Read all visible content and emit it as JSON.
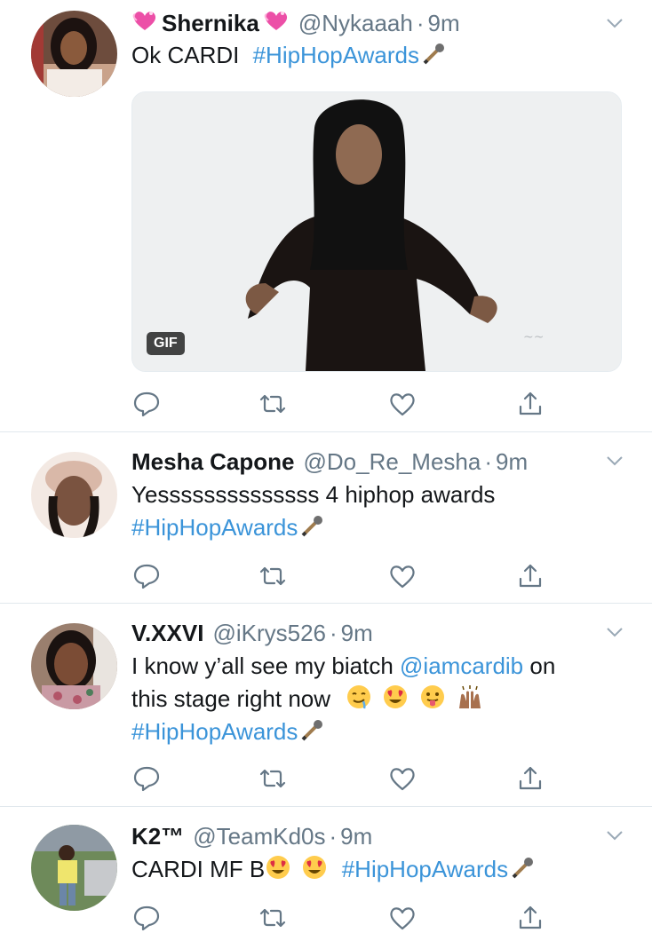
{
  "tweets": [
    {
      "display_name": "Shernika",
      "handle": "@Nykaaah",
      "time": "9m",
      "line1_text": "Ok CARDI",
      "line1_hashtag": "#HipHopAwards",
      "media_badge": "GIF"
    },
    {
      "display_name": "Mesha Capone",
      "handle": "@Do_Re_Mesha",
      "time": "9m",
      "line1_text": "Yessssssssssssss 4 hiphop awards",
      "line2_hashtag": "#HipHopAwards"
    },
    {
      "display_name": "V.XXVI",
      "handle": "@iKrys526",
      "time": "9m",
      "line1_text": "I know y’all see my biatch",
      "line1_mention": "@iamcardib",
      "line1_suffix": "on",
      "line2_text": "this stage right now",
      "line3_hashtag": "#HipHopAwards"
    },
    {
      "display_name": "K2™",
      "handle": "@TeamKd0s",
      "time": "9m",
      "line1_text": "CARDI MF B",
      "line1_hashtag": "#HipHopAwards"
    }
  ],
  "separator": "·",
  "icons": {
    "reply": "reply-icon",
    "retweet": "retweet-icon",
    "like": "heart-icon",
    "share": "share-icon",
    "menu": "chevron-down-icon"
  },
  "colors": {
    "link": "#3b94d9",
    "secondary": "#657786",
    "divider": "#e1e8ed"
  }
}
